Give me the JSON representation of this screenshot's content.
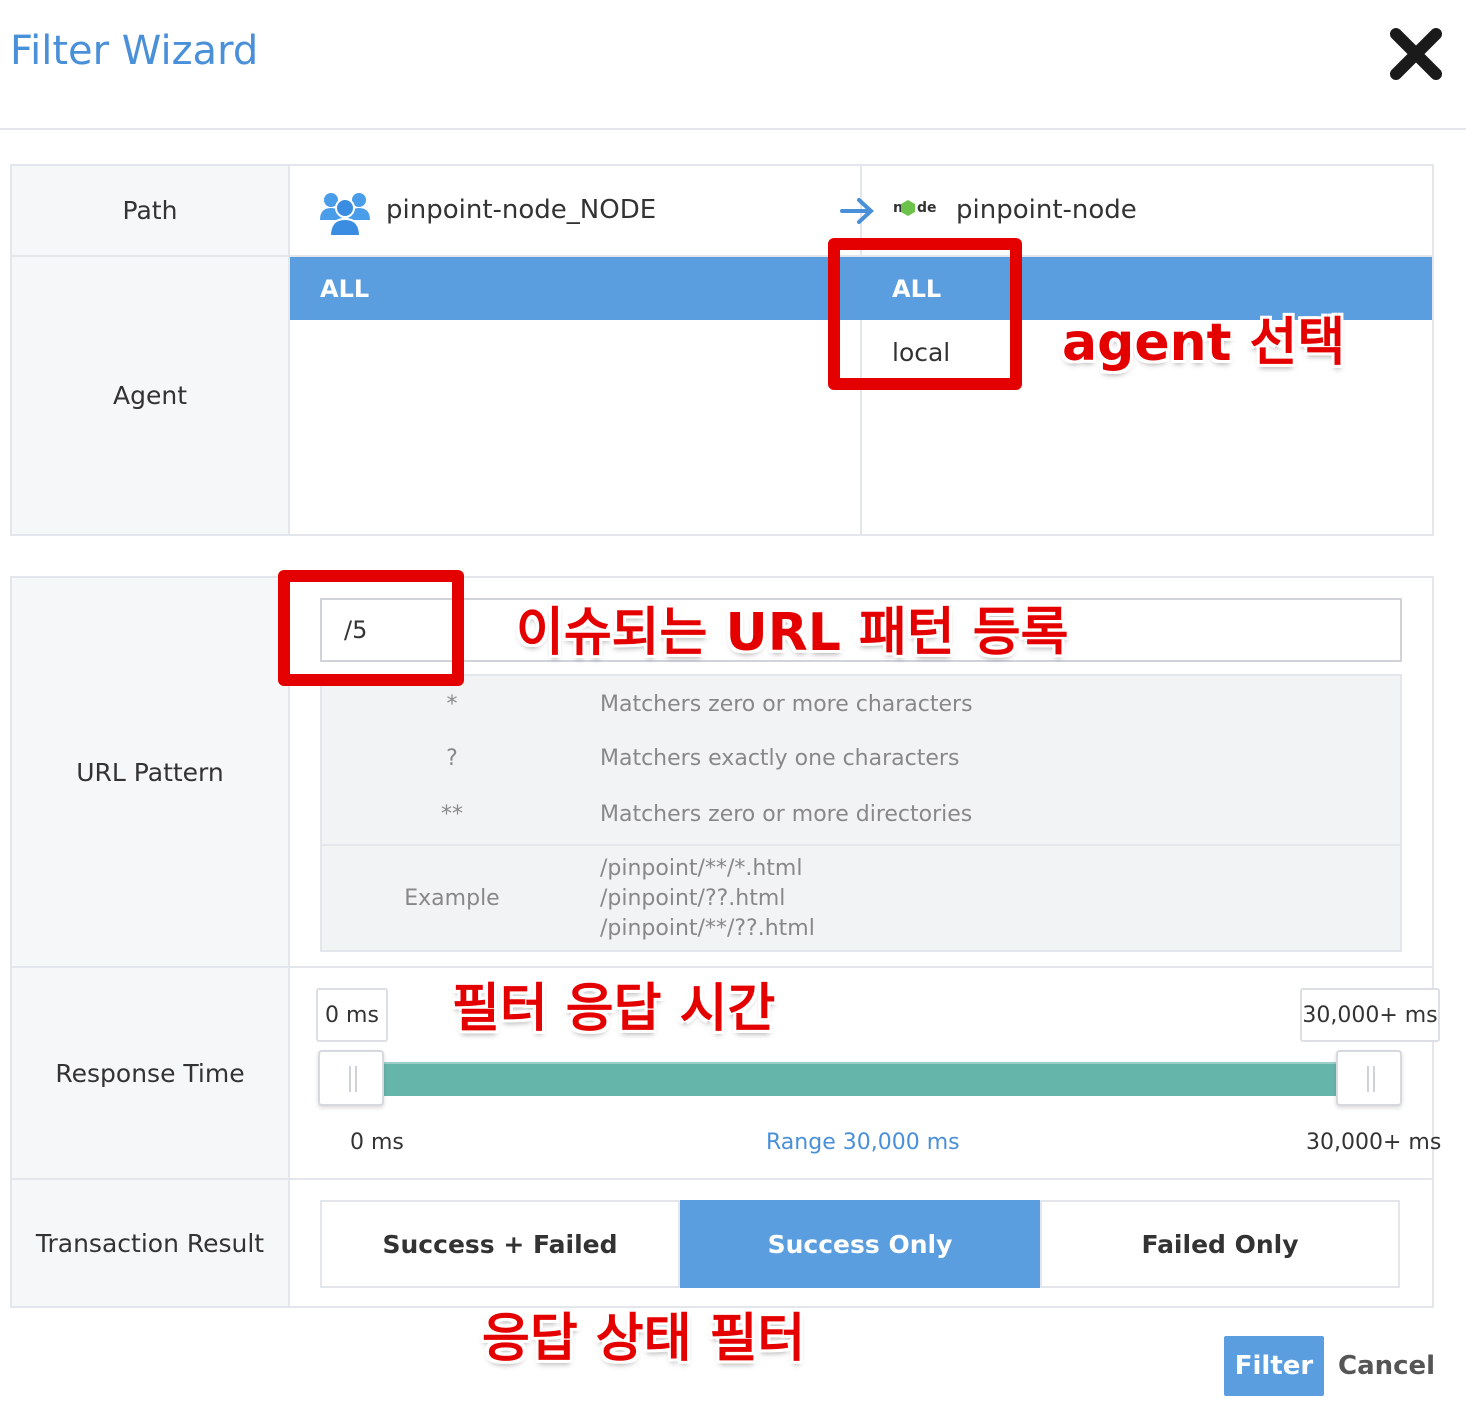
{
  "dialog": {
    "title": "Filter Wizard",
    "close_icon": "close-icon"
  },
  "labels": {
    "path": "Path",
    "agent": "Agent",
    "url_pattern": "URL Pattern",
    "response_time": "Response Time",
    "transaction_result": "Transaction Result"
  },
  "path": {
    "from_icon": "user-group-icon",
    "from": "pinpoint-node_NODE",
    "arrow_icon": "arrow-right-icon",
    "to_icon": "nodejs-logo-icon",
    "to": "pinpoint-node"
  },
  "agents": {
    "from_options": [
      "ALL"
    ],
    "to_options": [
      "ALL",
      "local"
    ]
  },
  "url": {
    "value": "/5",
    "help": [
      {
        "symbol": "*",
        "desc": "Matchers zero or more characters"
      },
      {
        "symbol": "?",
        "desc": "Matchers exactly one characters"
      },
      {
        "symbol": "**",
        "desc": "Matchers zero or more directories"
      }
    ],
    "example_label": "Example",
    "examples": [
      "/pinpoint/**/*.html",
      "/pinpoint/??.html",
      "/pinpoint/**/??.html"
    ]
  },
  "response_time": {
    "from_value": "0 ms",
    "to_value": "30,000+ ms",
    "scale_min": "0 ms",
    "scale_max": "30,000+ ms",
    "range": "Range 30,000 ms",
    "selected_fraction": [
      0,
      1
    ]
  },
  "transaction_result": {
    "options": [
      "Success + Failed",
      "Success Only",
      "Failed Only"
    ],
    "selected": "Success Only"
  },
  "buttons": {
    "filter": "Filter",
    "cancel": "Cancel"
  },
  "annotations": {
    "agent": "agent 선택",
    "url": "이슈되는 URL 패턴 등록",
    "response": "필터 응답 시간",
    "result": "응답 상태 필터"
  },
  "colors": {
    "accent": "#5b9ee0",
    "title": "#4a90d9",
    "slider": "#66b5ab",
    "annotation": "#e50000"
  }
}
